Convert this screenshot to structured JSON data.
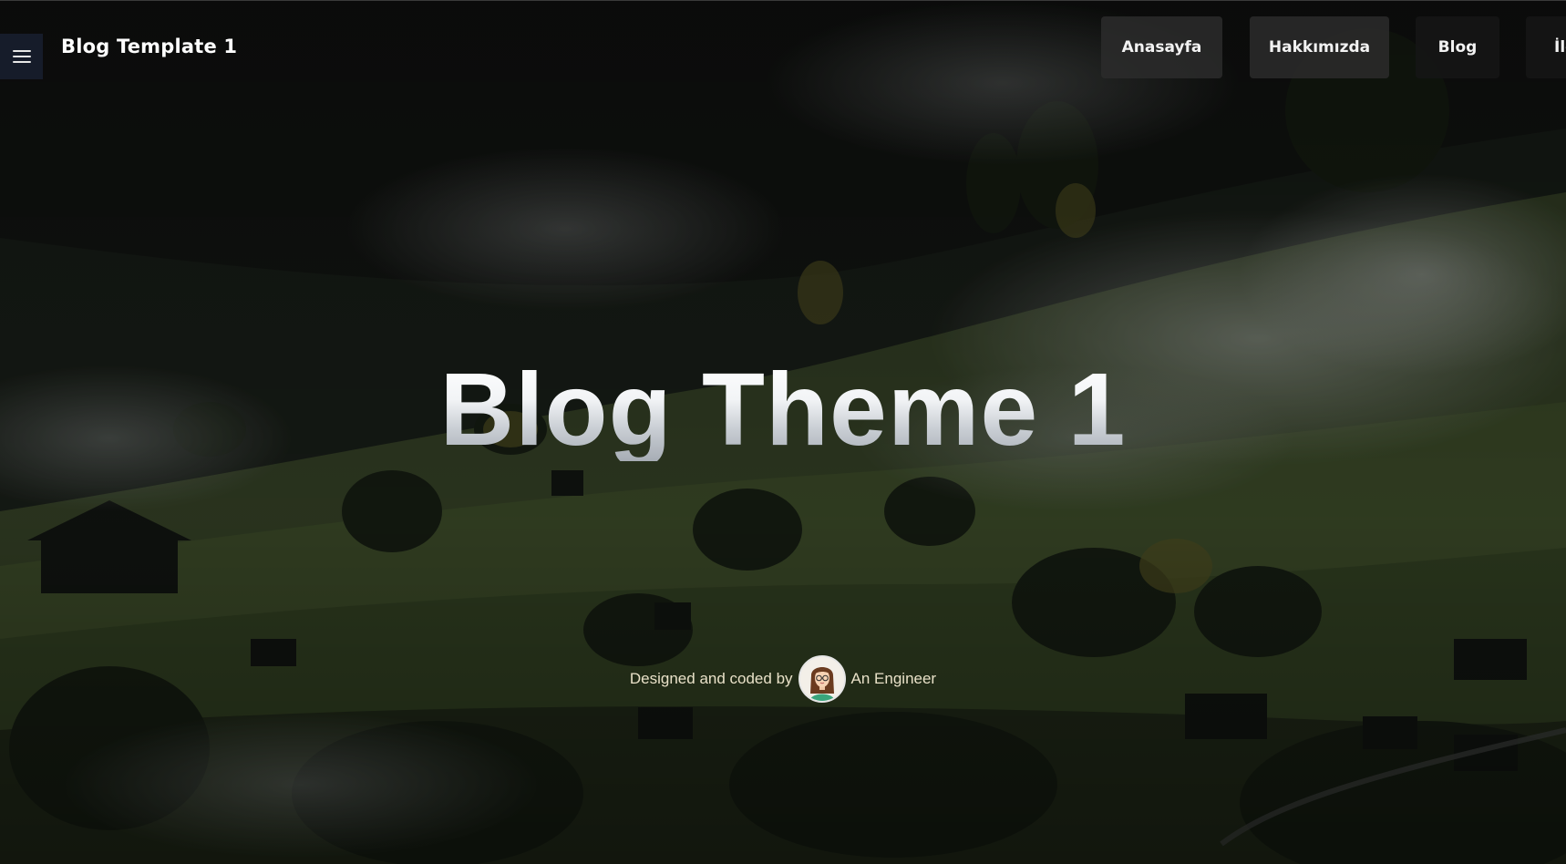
{
  "header": {
    "brand": "Blog Template 1",
    "menu_icon": "hamburger-icon"
  },
  "nav": {
    "items": [
      {
        "label": "Anasayfa"
      },
      {
        "label": "Hakkımızda"
      },
      {
        "label": "Blog"
      },
      {
        "label": "İle"
      }
    ]
  },
  "hero": {
    "title": "Blog Theme 1",
    "byline_prefix": "Designed and coded by",
    "author": "An Engineer",
    "avatar_icon": "engineer-avatar"
  },
  "colors": {
    "nav_bg": "#2c2c2c",
    "byline_text": "#e9e1c8",
    "menu_toggle_bg": "#192030"
  }
}
